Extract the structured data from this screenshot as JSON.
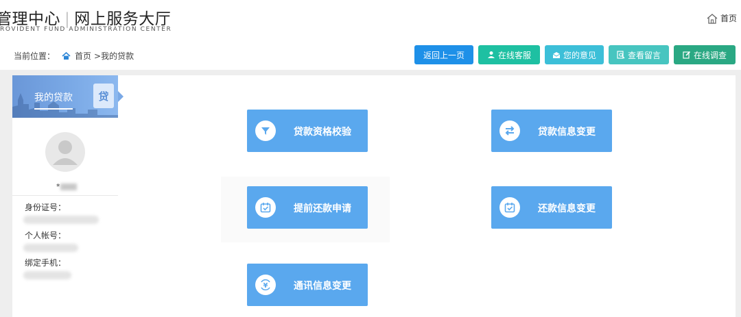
{
  "header": {
    "title_left": "管理中心",
    "title_right": "网上服务大厅",
    "subtitle": "ROVIDENT FUND ADMINISTRATION CENTER",
    "home_label": "首页"
  },
  "breadcrumb": {
    "prefix": "当前位置：",
    "home": "首页",
    "current": ">我的贷款"
  },
  "actions": {
    "back": "返回上一页",
    "service": "在线客服",
    "opinion": "您的意见",
    "message": "查看留言",
    "survey": "在线调查"
  },
  "sidebar": {
    "title": "我的贷款",
    "badge": "贷",
    "username_prefix": "*",
    "fields": [
      {
        "label": "身份证号："
      },
      {
        "label": "个人帐号："
      },
      {
        "label": "绑定手机："
      }
    ]
  },
  "tiles": [
    {
      "label": "贷款资格校验",
      "icon": "filter-icon"
    },
    {
      "label": "贷款信息变更",
      "icon": "swap-arrows-icon"
    },
    {
      "label": "提前还款申请",
      "icon": "calendar-check-icon"
    },
    {
      "label": "还款信息变更",
      "icon": "calendar-check-icon"
    },
    {
      "label": "通讯信息变更",
      "icon": "yen-cycle-icon"
    }
  ],
  "colors": {
    "tile_blue": "#5aa8ee",
    "back_button": "#1e90e8",
    "service_button": "#1ec0a2",
    "opinion_button": "#3cbfd8",
    "message_button": "#47c5c0",
    "survey_button": "#2aa883"
  }
}
